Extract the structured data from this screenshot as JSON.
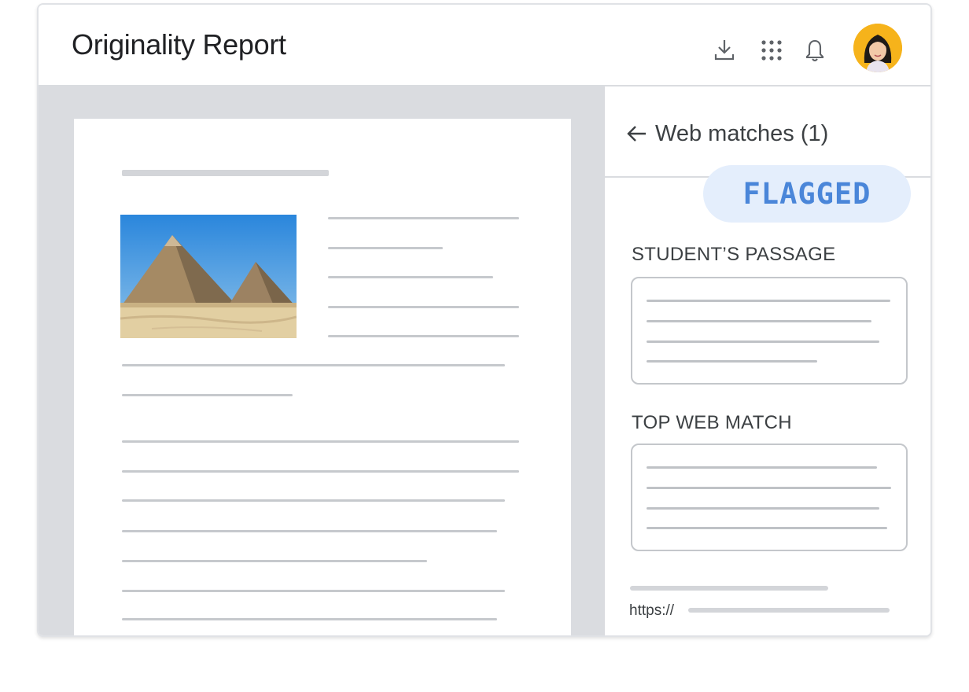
{
  "app": {
    "title": "Originality Report"
  },
  "header": {
    "icons": [
      "download-icon",
      "apps-grid-icon",
      "notifications-bell-icon"
    ],
    "avatar_background": "#f6b31b"
  },
  "panel": {
    "title": "Web matches (1)",
    "back_icon": "arrow-left-icon",
    "flag_badge": "FLAGGED",
    "student_passage_label": "STUDENT’S PASSAGE",
    "top_web_match_label": "TOP WEB MATCH",
    "url_prefix": "https://"
  },
  "colors": {
    "flag_text": "#4a86d9",
    "flag_background": "#e4eefc",
    "doc_background": "#dadce0"
  }
}
